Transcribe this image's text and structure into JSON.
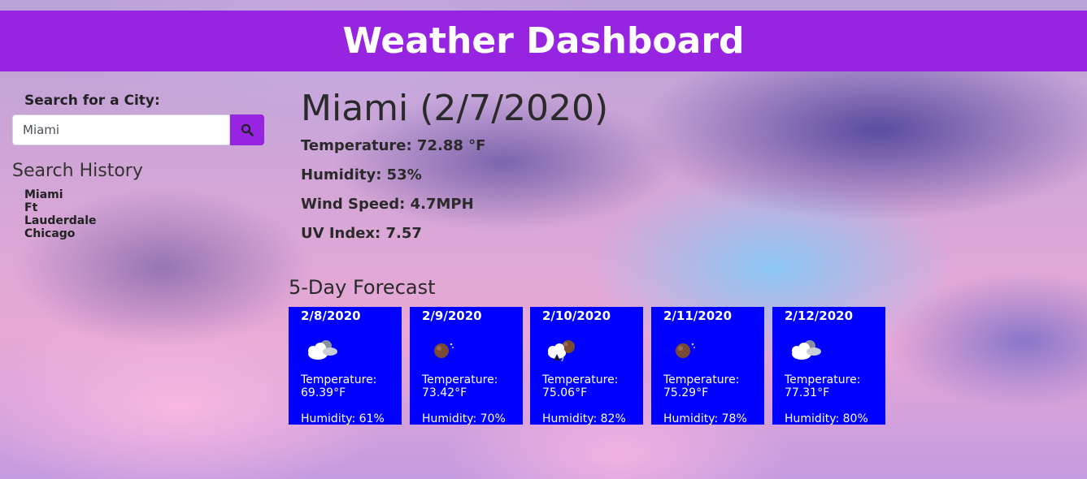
{
  "header": {
    "title": "Weather Dashboard"
  },
  "search": {
    "label": "Search for a City:",
    "value": "Miami",
    "button_icon": "search-icon"
  },
  "history": {
    "title": "Search History",
    "items": [
      "Miami",
      "Ft",
      "Lauderdale",
      "Chicago"
    ]
  },
  "current": {
    "title": "Miami (2/7/2020)",
    "temperature": "Temperature: 72.88 °F",
    "humidity": "Humidity: 53%",
    "wind": "Wind Speed: 4.7MPH",
    "uv": "UV Index: 7.57"
  },
  "forecast": {
    "title": "5-Day Forecast",
    "days": [
      {
        "date": "2/8/2020",
        "icon": "partly-cloudy-night-icon",
        "temp_label": "Temperature:",
        "temp": "69.39°F",
        "humidity": "Humidity: 61%"
      },
      {
        "date": "2/9/2020",
        "icon": "clear-night-icon",
        "temp_label": "Temperature:",
        "temp": "73.42°F",
        "humidity": "Humidity: 70%"
      },
      {
        "date": "2/10/2020",
        "icon": "rain-night-icon",
        "temp_label": "Temperature:",
        "temp": "75.06°F",
        "humidity": "Humidity: 82%"
      },
      {
        "date": "2/11/2020",
        "icon": "clear-night-icon",
        "temp_label": "Temperature:",
        "temp": "75.29°F",
        "humidity": "Humidity: 78%"
      },
      {
        "date": "2/12/2020",
        "icon": "partly-cloudy-night-icon",
        "temp_label": "Temperature:",
        "temp": "77.31°F",
        "humidity": "Humidity: 80%"
      }
    ]
  },
  "colors": {
    "header_bg": "#9624e1",
    "card_bg": "#0000ff",
    "button_bg": "#9624e1"
  }
}
